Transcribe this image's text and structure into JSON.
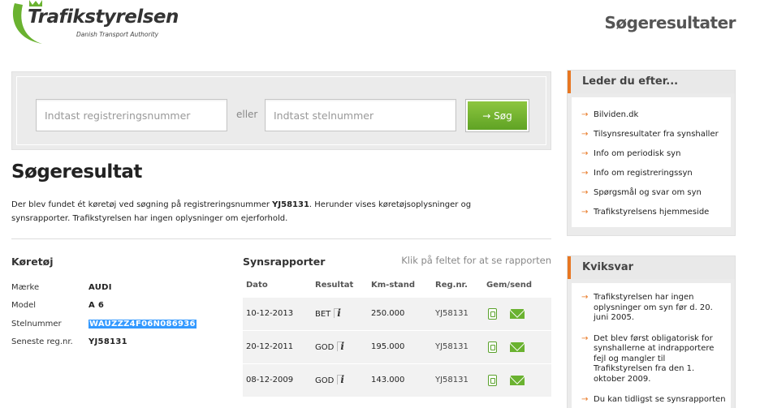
{
  "header": {
    "logo_name": "Trafikstyrelsen",
    "logo_sub": "Danish Transport Authority",
    "page_heading": "Søgeresultater"
  },
  "search": {
    "reg_placeholder": "Indtast registreringsnummer",
    "or_label": "eller",
    "vin_placeholder": "Indtast stelnummer",
    "button_label": "→ Søg"
  },
  "result": {
    "title": "Søgeresultat",
    "desc_prefix": "Der blev fundet ét køretøj ved søgning på registreringsnummer ",
    "desc_reg": "YJ58131",
    "desc_suffix": ". Herunder vises køretøjsoplysninger og synsrapporter. Trafikstyrelsen har ingen oplysninger om ejerforhold."
  },
  "vehicle": {
    "title": "Køretøj",
    "rows": [
      {
        "label": "Mærke",
        "value": "AUDI"
      },
      {
        "label": "Model",
        "value": "A 6"
      },
      {
        "label": "Stelnummer",
        "value": "WAUZZZ4F06N086936"
      },
      {
        "label": "Seneste reg.nr.",
        "value": "YJ58131"
      }
    ]
  },
  "reports": {
    "title": "Synsrapporter",
    "hint": "Klik på feltet for at se rapporten",
    "columns": [
      "Dato",
      "Resultat",
      "Km-stand",
      "Reg.nr.",
      "Gem/send"
    ],
    "rows": [
      {
        "date": "10-12-2013",
        "result": "BET",
        "km": "250.000",
        "reg": "YJ58131"
      },
      {
        "date": "20-12-2011",
        "result": "GOD",
        "km": "195.000",
        "reg": "YJ58131"
      },
      {
        "date": "08-12-2009",
        "result": "GOD",
        "km": "143.000",
        "reg": "YJ58131"
      }
    ],
    "info_glyph": "i"
  },
  "sidebar": {
    "lookfor_title": "Leder du efter...",
    "links": [
      "Bilviden.dk",
      "Tilsynsresultater fra synshaller",
      "Info om periodisk syn",
      "Info om registreringssyn",
      "Spørgsmål og svar om syn",
      "Trafikstyrelsens hjemmeside"
    ],
    "quick_title": "Kviksvar",
    "quick_items": [
      "Trafikstyrelsen har ingen oplysninger om syn før d. 20. juni 2005.",
      "Det blev først obligatorisk for synshallerne at indrapportere fejl og mangler til Trafikstyrelsen fra den 1. oktober 2009.",
      "Du kan tidligst se synsrapporten"
    ],
    "arrow_glyph": "→"
  },
  "colors": {
    "accent_orange": "#e87722",
    "brand_green": "#6ab230",
    "selection_blue": "#3399ff"
  }
}
